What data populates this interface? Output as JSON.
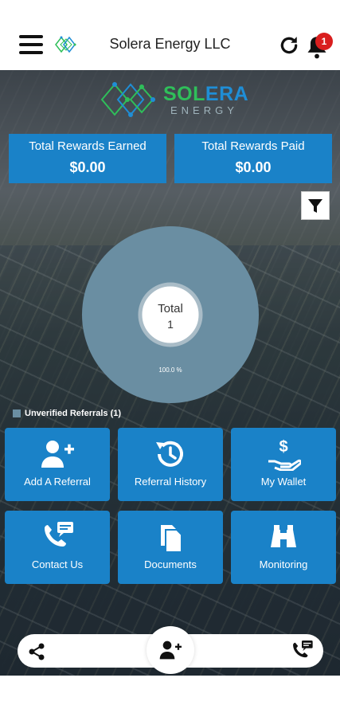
{
  "header": {
    "title": "Solera Energy LLC",
    "notification_count": "1"
  },
  "brand": {
    "word_part1": "SOL",
    "word_part2": "ERA",
    "subtitle": "ENERGY"
  },
  "rewards": {
    "earned_label": "Total Rewards Earned",
    "earned_value": "$0.00",
    "paid_label": "Total Rewards Paid",
    "paid_value": "$0.00"
  },
  "chart_data": {
    "type": "pie",
    "categories": [
      "Unverified Referrals"
    ],
    "values": [
      1
    ],
    "center_label": "Total",
    "center_value": "1",
    "slice_labels": [
      "100.0 %"
    ],
    "colors": [
      "#6a8ea2"
    ],
    "legend": {
      "placement": "bottom-left",
      "entries": [
        {
          "name": "Unverified Referrals",
          "count": "(1)"
        }
      ]
    }
  },
  "tiles": [
    {
      "label": "Add A Referral",
      "icon": "add-user-icon"
    },
    {
      "label": "Referral History",
      "icon": "history-icon"
    },
    {
      "label": "My Wallet",
      "icon": "wallet-hand-icon"
    },
    {
      "label": "Contact Us",
      "icon": "phone-message-icon"
    },
    {
      "label": "Documents",
      "icon": "documents-icon"
    },
    {
      "label": "Monitoring",
      "icon": "binoculars-icon"
    }
  ],
  "colors": {
    "primary": "#1a82c8",
    "chart_slice": "#6a8ea2",
    "badge": "#d91e1e",
    "brand_green": "#2fbf5a",
    "brand_blue": "#1f8ed6"
  }
}
